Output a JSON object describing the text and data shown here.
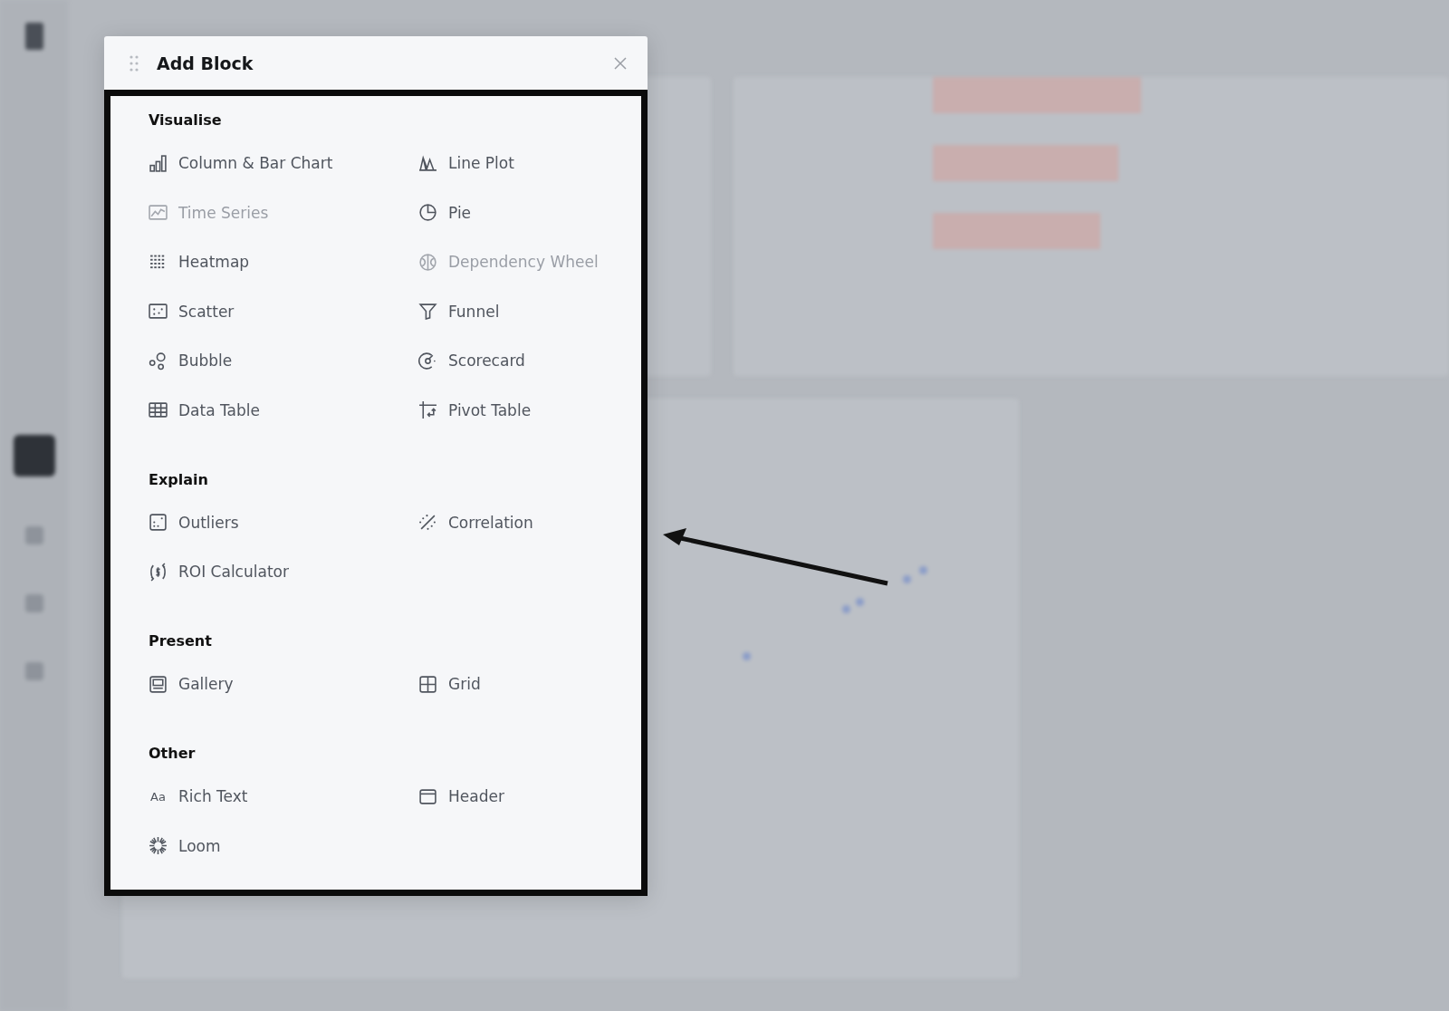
{
  "dialog": {
    "title": "Add Block",
    "sections": [
      {
        "title": "Visualise",
        "items": [
          {
            "kind": "column",
            "label": "Column & Bar Chart",
            "disabled": false
          },
          {
            "kind": "line",
            "label": "Line Plot",
            "disabled": false
          },
          {
            "kind": "timeseries",
            "label": "Time Series",
            "disabled": true
          },
          {
            "kind": "pie",
            "label": "Pie",
            "disabled": false
          },
          {
            "kind": "heatmap",
            "label": "Heatmap",
            "disabled": false
          },
          {
            "kind": "wheel",
            "label": "Dependency Wheel",
            "disabled": true
          },
          {
            "kind": "scatter",
            "label": "Scatter",
            "disabled": false
          },
          {
            "kind": "funnel",
            "label": "Funnel",
            "disabled": false
          },
          {
            "kind": "bubble",
            "label": "Bubble",
            "disabled": false
          },
          {
            "kind": "scorecard",
            "label": "Scorecard",
            "disabled": false
          },
          {
            "kind": "table",
            "label": "Data Table",
            "disabled": false
          },
          {
            "kind": "pivot",
            "label": "Pivot Table",
            "disabled": false
          }
        ]
      },
      {
        "title": "Explain",
        "items": [
          {
            "kind": "outliers",
            "label": "Outliers",
            "disabled": false
          },
          {
            "kind": "correlation",
            "label": "Correlation",
            "disabled": false
          },
          {
            "kind": "roi",
            "label": "ROI Calculator",
            "disabled": false
          }
        ]
      },
      {
        "title": "Present",
        "items": [
          {
            "kind": "gallery",
            "label": "Gallery",
            "disabled": false
          },
          {
            "kind": "grid",
            "label": "Grid",
            "disabled": false
          }
        ]
      },
      {
        "title": "Other",
        "items": [
          {
            "kind": "text",
            "label": "Rich Text",
            "icon_text": "Aa",
            "disabled": false
          },
          {
            "kind": "header",
            "label": "Header",
            "disabled": false
          },
          {
            "kind": "loom",
            "label": "Loom",
            "disabled": false
          }
        ]
      }
    ]
  }
}
